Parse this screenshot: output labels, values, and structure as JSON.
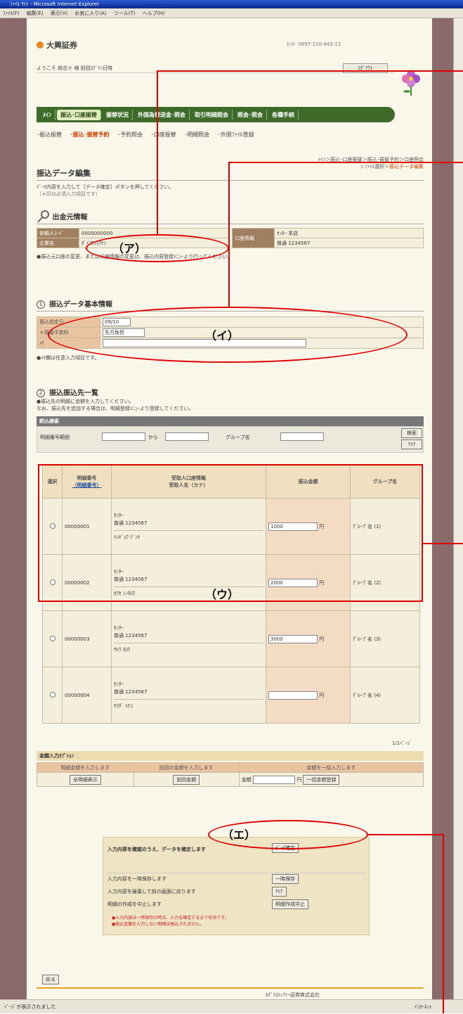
{
  "window": {
    "title": "ﾌｧｲﾙ ｻｲﾄ - Microsoft Internet Explorer"
  },
  "menubar": {
    "items": [
      "ﾌｧｲﾙ(F)",
      "編集(E)",
      "表示(V)",
      "お気に入り(A)",
      "ツール(T)",
      "ヘルプ(H)"
    ]
  },
  "header": {
    "logo": "大興証券",
    "right_text": "ｾﾝﾀｰ 0897-220-443-13",
    "user_line": "ようこそ 総合テ 様 前回ﾛｸﾞｲﾝ日時",
    "logout": "ﾛｸﾞｱｳﾄ"
  },
  "navbar": {
    "items": [
      "ﾒｲﾝ",
      "振込･口座振替",
      "振替状況",
      "外国為替送金･照会",
      "取引明細照会",
      "照会･照会",
      "各種手続"
    ],
    "active_index": 1
  },
  "subnav": {
    "items": [
      "･振込振替",
      "･振込･振替予約",
      "･予約照会",
      "･口座振替",
      "･明細照会",
      "･外国ﾌｧｲﾙ登録"
    ],
    "active_index": 1
  },
  "page": {
    "title": "振込データ編集",
    "breadcrumb_1": "ﾒｲﾝ＞振込･口座振替＞振込･振替予約＞口座照会",
    "breadcrumb_2": "＞ﾌｧｲﾙ選択＞",
    "breadcrumb_current": "振込データ編集",
    "desc_1": "ﾃﾞｰﾀ内容を入力して［データ確定］ボタンを押してください。",
    "desc_2": "（＊印は必須入力項目です）"
  },
  "source": {
    "title": "出金元情報",
    "rows": [
      {
        "label": "依頼人ｺｰﾄﾞ",
        "value": "0000000000"
      },
      {
        "label": "企業名",
        "value": "ﾀﾞｲｺｳｼｮｳｹﾝ"
      }
    ],
    "account_label": "口座情報",
    "account_value_1": "ｾﾝﾀｰ 本店",
    "account_value_2": "普通 1234567",
    "note": "●振込元口座の変更、または口座情報の変更は、振込内容登録ﾒﾆｭｰより行ってください。"
  },
  "basic": {
    "num": "1",
    "title": "振込データ基本情報",
    "rows": [
      {
        "label": "振込指定日",
        "value": "09/10"
      },
      {
        "label": "＊振替手数料",
        "value": "先方負担"
      },
      {
        "label": "ﾒﾓ",
        "value": ""
      }
    ],
    "note": "●ﾒﾓ欄は任意入力項目です。"
  },
  "payees": {
    "num": "2",
    "title": "振込振込先一覧",
    "note_1": "●振込先の明細に金額を入力してください。",
    "note_2": "なお、振込先を追加する場合は、明細登録ﾒﾆｭｰより登録してください。",
    "search_title": "絞込検索",
    "search_label": "明細番号範囲",
    "search_to": "から",
    "group_label": "グループ名",
    "search_btn": "検索",
    "clear_btn": "ｸﾘｱ",
    "headers": [
      "選択",
      "明細番号",
      "受取人口座情報",
      "振込金額",
      "グループ名"
    ],
    "header_sub_1": "（明細番号）",
    "header_sub_2": "受取人名（カナ）",
    "rows": [
      {
        "no": "00000001",
        "bank": "ｾﾝﾀｰ",
        "branch": "普通 1234567",
        "name": "ﾄｼｷﾞｮｳ ﾃﾞﾝｷ",
        "amount": "1000",
        "group": "ｸﾞﾙｰﾌﾟ名 (1)"
      },
      {
        "no": "00000002",
        "bank": "ｾﾝﾀｰ",
        "branch": "普通 1234567",
        "name": "ｶﾜｾ ｼﾝﾀﾛｳ",
        "amount": "2000",
        "group": "ｸﾞﾙｰﾌﾟ名 (2)"
      },
      {
        "no": "00000003",
        "bank": "ｾﾝﾀｰ",
        "branch": "普通 1234567",
        "name": "ｻﾄｳ ﾀﾛｳ",
        "amount": "3000",
        "group": "ｸﾞﾙｰﾌﾟ名 (3)"
      },
      {
        "no": "00000004",
        "bank": "ｾﾝﾀｰ",
        "branch": "普通 1234567",
        "name": "ﾔﾏﾀﾞ ﾊﾅｺ",
        "amount": "",
        "group": "ｸﾞﾙｰﾌﾟ名 (4)"
      }
    ],
    "count": "1/1ﾍﾟｰｼﾞ",
    "yen": "円"
  },
  "options": {
    "title": "金額入力ｵﾌﾟｼｮﾝ",
    "cols": [
      "明細金額を入力します",
      "前回の金額を入力します",
      "金額を一括入力します"
    ],
    "btn_1": "全明細表示",
    "btn_2": "前回金額",
    "label_3": "金額",
    "btn_3": "一括金額登録",
    "yen": "円"
  },
  "actions": {
    "confirm_text": "入力内容を確認のうえ、データを確定します",
    "confirm_btn": "ﾃﾞｰﾀ確定",
    "row2": "入力内容を一時保存します",
    "row2_btn": "一時保存",
    "row3": "入力内容を破棄して前の画面に戻ります",
    "row3_btn": "ｸﾘｱ",
    "row4": "明細の作成を中止します",
    "row4_btn": "明細作成中止",
    "warn_1": "●入力内容は一時保存の時点、入力を確定するまで有効です。",
    "warn_2": "●振込金額を入力しない明細は振込されません。"
  },
  "footer": {
    "back": "戻る",
    "note": "ｶｸﾞﾗｽﾃｨｸﾃｰ証券株式会社"
  },
  "status": {
    "left": "ﾍﾟｰｼﾞが表示されました",
    "right": "ｲﾝﾀｰﾈｯﾄ"
  },
  "markers": {
    "a": "（ア）",
    "i": "（イ）",
    "u": "（ウ）",
    "e": "（エ）"
  }
}
